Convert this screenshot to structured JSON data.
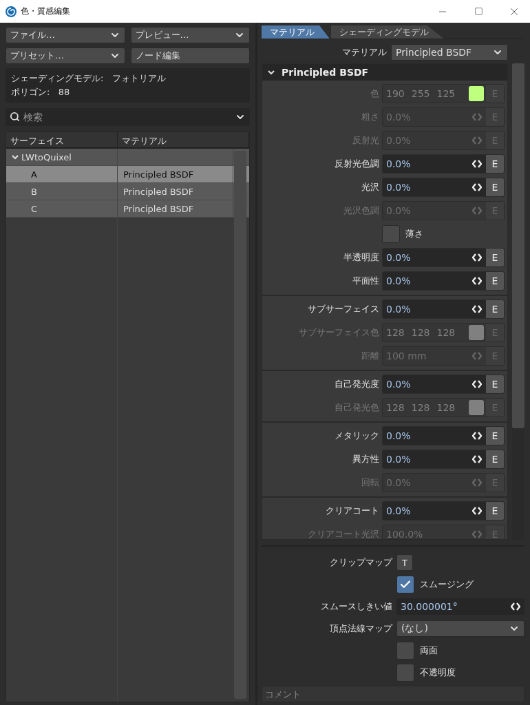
{
  "window": {
    "title": "色・質感編集"
  },
  "toolbar": [
    {
      "kind": "dropdown",
      "label": "ファイル…"
    },
    {
      "kind": "dropdown",
      "label": "プレビュー…"
    },
    {
      "kind": "dropdown",
      "label": "プリセット…"
    },
    {
      "kind": "button",
      "label": "ノード編集"
    }
  ],
  "info": [
    {
      "label": "シェーディングモデル:",
      "value": "フォトリアル"
    },
    {
      "label": "ポリゴン:",
      "value": "88"
    }
  ],
  "search": {
    "placeholder": "検索"
  },
  "table": {
    "columns": [
      "サーフェイス",
      "マテリアル"
    ],
    "rows": [
      {
        "surface": "LWtoQuixel",
        "expanded": true,
        "children": [
          {
            "surface": "A",
            "material": "Principled BSDF",
            "selected": true
          },
          {
            "surface": "B",
            "material": "Principled BSDF",
            "selected": false
          },
          {
            "surface": "C",
            "material": "Principled BSDF",
            "selected": false
          }
        ]
      }
    ]
  },
  "tabs": [
    {
      "label": "マテリアル",
      "selected": true
    },
    {
      "label": "シェーディングモデル",
      "selected": false
    }
  ],
  "material_select": {
    "label": "マテリアル",
    "value": "Principled BSDF"
  },
  "section": {
    "title": "Principled BSDF",
    "expanded": true,
    "groups": [
      {
        "rows": [
          {
            "kind": "color",
            "label": "色",
            "values": [
              "190",
              "255",
              "125"
            ],
            "button": "E",
            "disabled": true
          },
          {
            "kind": "number",
            "label": "粗さ",
            "value": "0.0%",
            "button": "E",
            "disabled": true
          },
          {
            "kind": "number",
            "label": "反射光",
            "value": "0.0%",
            "button": "E",
            "disabled": true
          },
          {
            "kind": "number",
            "label": "反射光色調",
            "value": "0.0%",
            "button": "E",
            "disabled": false
          },
          {
            "kind": "number",
            "label": "光沢",
            "value": "0.0%",
            "button": "E",
            "disabled": false
          },
          {
            "kind": "number",
            "label": "光沢色調",
            "value": "0.0%",
            "button": "E",
            "disabled": true
          },
          {
            "kind": "checkbox",
            "label": "薄さ",
            "checked": false
          },
          {
            "kind": "number",
            "label": "半透明度",
            "value": "0.0%",
            "button": "E",
            "disabled": false
          },
          {
            "kind": "number",
            "label": "平面性",
            "value": "0.0%",
            "button": "E",
            "disabled": false
          }
        ]
      },
      {
        "rows": [
          {
            "kind": "number",
            "label": "サブサーフェイス",
            "value": "0.0%",
            "button": "E",
            "disabled": false
          },
          {
            "kind": "color",
            "label": "サブサーフェイス色",
            "values": [
              "128",
              "128",
              "128"
            ],
            "button": "E",
            "disabled": true
          },
          {
            "kind": "number",
            "label": "距離",
            "value": "100 mm",
            "button": "E",
            "disabled": true
          }
        ]
      },
      {
        "rows": [
          {
            "kind": "number",
            "label": "自己発光度",
            "value": "0.0%",
            "button": "E",
            "disabled": false
          },
          {
            "kind": "color",
            "label": "自己発光色",
            "values": [
              "128",
              "128",
              "128"
            ],
            "button": "E",
            "disabled": true
          }
        ]
      },
      {
        "rows": [
          {
            "kind": "number",
            "label": "メタリック",
            "value": "0.0%",
            "button": "E",
            "disabled": false
          },
          {
            "kind": "number",
            "label": "異方性",
            "value": "0.0%",
            "button": "E",
            "disabled": false
          },
          {
            "kind": "number",
            "label": "回転",
            "value": "0.0%",
            "button": "E",
            "disabled": true
          }
        ]
      },
      {
        "rows": [
          {
            "kind": "number",
            "label": "クリアコート",
            "value": "0.0%",
            "button": "E",
            "disabled": false
          },
          {
            "kind": "number",
            "label": "クリアコート光沢",
            "value": "100.0%",
            "button": "E",
            "disabled": true
          }
        ]
      }
    ]
  },
  "bottom": [
    {
      "kind": "button",
      "label": "クリップマップ",
      "value": "T"
    },
    {
      "kind": "checkbox",
      "label": "スムージング",
      "checked": true
    },
    {
      "kind": "number",
      "label": "スムースしきい値",
      "value": "30.000001°"
    },
    {
      "kind": "dropdown",
      "label": "頂点法線マップ",
      "value": "(なし)"
    },
    {
      "kind": "checkbox",
      "label": "両面",
      "checked": false
    },
    {
      "kind": "checkbox",
      "label": "不透明度",
      "checked": false
    }
  ],
  "comment": {
    "placeholder": "コメント"
  }
}
